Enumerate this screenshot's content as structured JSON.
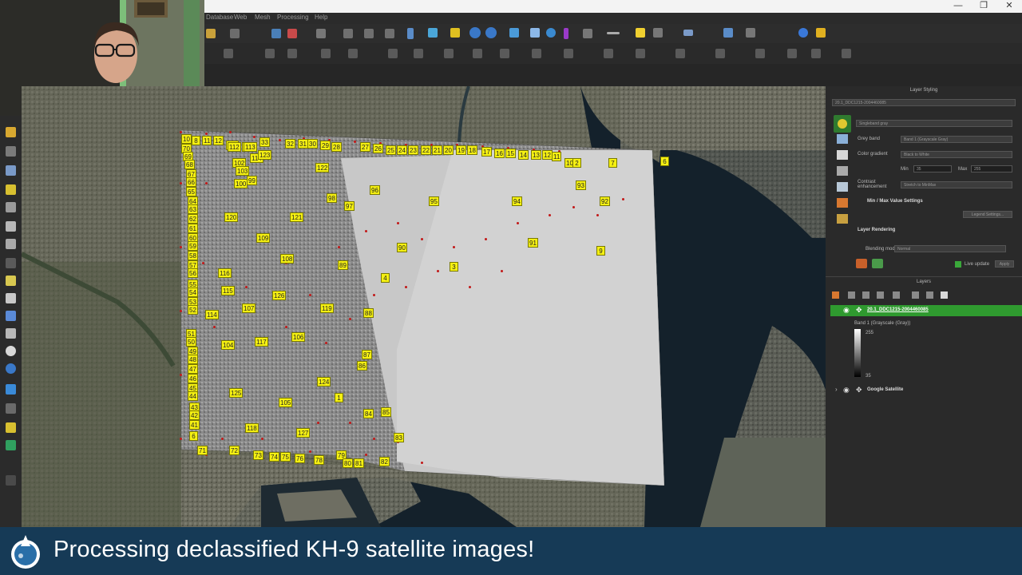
{
  "window": {
    "minimize_symbol": "—",
    "maximize_symbol": "❐",
    "close_symbol": "✕"
  },
  "menubar": {
    "items": [
      "Database",
      "Web",
      "Mesh",
      "Processing",
      "Help"
    ]
  },
  "layer_styling": {
    "panel_title": "Layer Styling",
    "layer_selector": "20.1_DDC1215-2004460085",
    "renderer": "Singleband gray",
    "gray_band_label": "Grey band",
    "gray_band_value": "Band 1 (Grayscale Gray)",
    "color_gradient_label": "Color gradient",
    "color_gradient_value": "Black to White",
    "min_label": "Min",
    "min_value": "35",
    "max_label": "Max",
    "max_value": "255",
    "contrast_label": "Contrast enhancement",
    "contrast_value": "Stretch to MinMax",
    "minmax_section": "Min / Max Value Settings",
    "legend_settings_button": "Legend Settings...",
    "layer_rendering_section": "Layer Rendering",
    "blending_label": "Blending mode",
    "blending_value": "Normal",
    "live_update_label": "Live update",
    "apply_button": "Apply"
  },
  "layers_panel": {
    "title": "Layers",
    "layers": [
      {
        "name": "20.1_DDC1215-2004460085",
        "legend_title": "Band 1 (Grayscale (Gray))",
        "legend_max": "255",
        "legend_min": "35"
      },
      {
        "name": "Google Satellite"
      }
    ]
  },
  "gcp_markers": [
    "10",
    "8",
    "11",
    "12",
    "111",
    "113",
    "33",
    "32",
    "31",
    "30",
    "29",
    "28",
    "27",
    "26",
    "25",
    "24",
    "23",
    "22",
    "21",
    "20",
    "19",
    "18",
    "17",
    "16",
    "15",
    "14",
    "13",
    "12",
    "11",
    "10",
    "9",
    "6",
    "2",
    "7",
    "112",
    "113",
    "114",
    "123",
    "102",
    "103",
    "100",
    "99",
    "122",
    "96",
    "98",
    "97",
    "95",
    "94",
    "93",
    "92",
    "91",
    "90",
    "89",
    "4",
    "3",
    "120",
    "121",
    "109",
    "108",
    "116",
    "115",
    "107",
    "126",
    "119",
    "88",
    "114",
    "104",
    "117",
    "106",
    "87",
    "86",
    "124",
    "125",
    "1",
    "105",
    "84",
    "85",
    "118",
    "127",
    "83",
    "72",
    "73",
    "74",
    "75",
    "76",
    "78",
    "79",
    "80",
    "81",
    "82",
    "71",
    "70",
    "69",
    "68",
    "67",
    "66",
    "65",
    "64",
    "63",
    "62",
    "61",
    "60",
    "59",
    "58",
    "57",
    "56",
    "55",
    "54",
    "53",
    "52",
    "51",
    "50",
    "49",
    "48",
    "47",
    "46",
    "45",
    "44",
    "43",
    "42",
    "41",
    "6"
  ],
  "caption": {
    "text": "Processing declassified KH-9 satellite images!",
    "accent_color": "#163a56"
  }
}
